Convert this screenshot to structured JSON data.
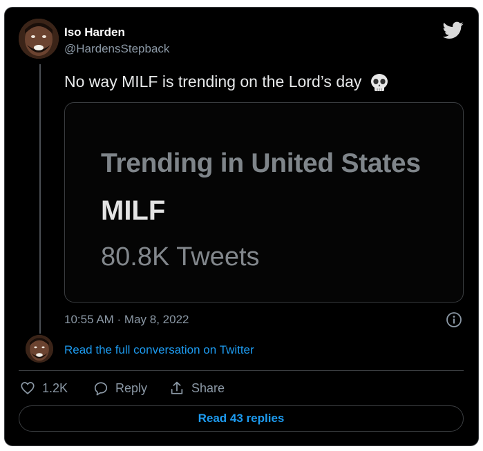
{
  "author": {
    "name": "Iso Harden",
    "handle": "@HardensStepback"
  },
  "tweet": {
    "text": "No way MILF is trending on the Lord’s day",
    "emoji": "skull-icon",
    "timestamp": "10:55 AM · May 8, 2022"
  },
  "media": {
    "line1": "Trending in United States",
    "line2": "MILF",
    "line3": "80.8K Tweets"
  },
  "conversation": {
    "link_label": "Read the full conversation on Twitter"
  },
  "actions": {
    "like_count": "1.2K",
    "reply_label": "Reply",
    "share_label": "Share"
  },
  "replies_button": {
    "label": "Read 43 replies"
  },
  "colors": {
    "background": "#000000",
    "accent": "#1d9bf0",
    "secondary_text": "#8b98a5"
  }
}
